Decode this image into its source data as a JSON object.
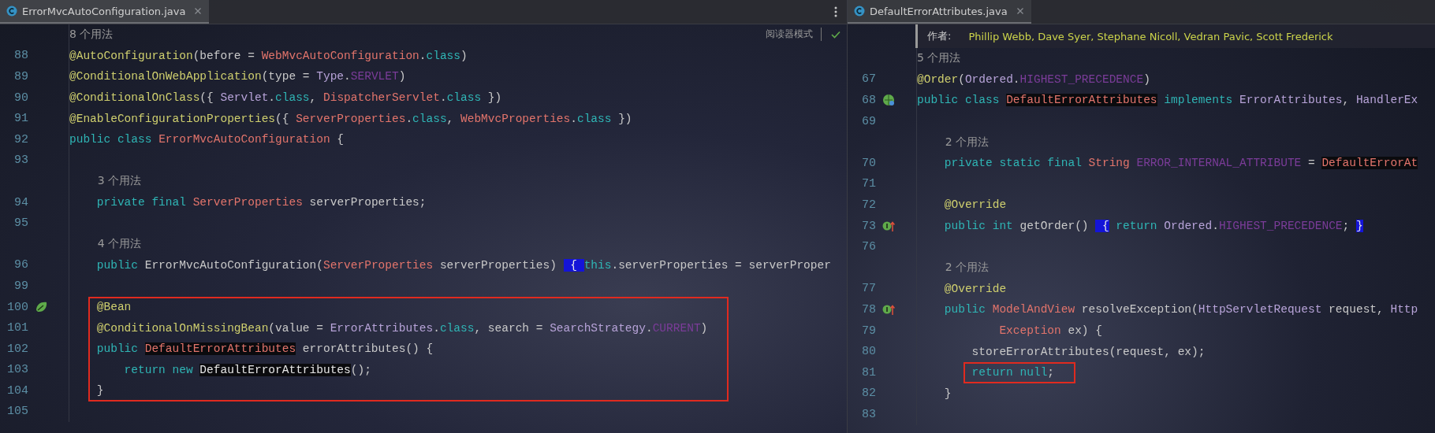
{
  "panes": [
    {
      "tab": {
        "title": "ErrorMvcAutoConfiguration.java"
      },
      "reader_mode": "阅读器模式",
      "lines": [
        {
          "kind": "usage",
          "text": "8 个用法",
          "indented": false
        },
        {
          "kind": "code",
          "number": "88",
          "boxed": false,
          "tokens": [
            {
              "t": "@AutoConfiguration",
              "kind": "an"
            },
            {
              "t": "(before = ",
              "kind": "p"
            },
            {
              "t": "WebMvcAutoConfiguration",
              "kind": "cls"
            },
            {
              "t": ".",
              "kind": "p"
            },
            {
              "t": "class",
              "kind": "kw"
            },
            {
              "t": ")",
              "kind": "p"
            }
          ]
        },
        {
          "kind": "code",
          "number": "89",
          "boxed": false,
          "tokens": [
            {
              "t": "@ConditionalOnWebApplication",
              "kind": "an"
            },
            {
              "t": "(type = ",
              "kind": "p"
            },
            {
              "t": "Type",
              "kind": "typ"
            },
            {
              "t": ".",
              "kind": "p"
            },
            {
              "t": "SERVLET",
              "kind": "cst"
            },
            {
              "t": ")",
              "kind": "p"
            }
          ]
        },
        {
          "kind": "code",
          "number": "90",
          "boxed": false,
          "tokens": [
            {
              "t": "@ConditionalOnClass",
              "kind": "an"
            },
            {
              "t": "({ ",
              "kind": "p"
            },
            {
              "t": "Servlet",
              "kind": "typ"
            },
            {
              "t": ".",
              "kind": "p"
            },
            {
              "t": "class",
              "kind": "kw"
            },
            {
              "t": ", ",
              "kind": "p"
            },
            {
              "t": "DispatcherServlet",
              "kind": "cls"
            },
            {
              "t": ".",
              "kind": "p"
            },
            {
              "t": "class",
              "kind": "kw"
            },
            {
              "t": " })",
              "kind": "p"
            }
          ]
        },
        {
          "kind": "code",
          "number": "91",
          "boxed": false,
          "tokens": [
            {
              "t": "@EnableConfigurationProperties",
              "kind": "an"
            },
            {
              "t": "({ ",
              "kind": "p"
            },
            {
              "t": "ServerProperties",
              "kind": "cls"
            },
            {
              "t": ".",
              "kind": "p"
            },
            {
              "t": "class",
              "kind": "kw"
            },
            {
              "t": ", ",
              "kind": "p"
            },
            {
              "t": "WebMvcProperties",
              "kind": "cls"
            },
            {
              "t": ".",
              "kind": "p"
            },
            {
              "t": "class",
              "kind": "kw"
            },
            {
              "t": " })",
              "kind": "p"
            }
          ]
        },
        {
          "kind": "code",
          "number": "92",
          "boxed": false,
          "tokens": [
            {
              "t": "public class ",
              "kind": "kw"
            },
            {
              "t": "ErrorMvcAutoConfiguration",
              "kind": "cls"
            },
            {
              "t": " {",
              "kind": "p"
            }
          ]
        },
        {
          "kind": "code",
          "number": "93",
          "boxed": false
        },
        {
          "kind": "usage",
          "text": "3 个用法",
          "indented": true
        },
        {
          "kind": "code",
          "number": "94",
          "boxed": false,
          "tokens": [
            {
              "t": "    private final ",
              "kind": "kw"
            },
            {
              "t": "ServerProperties",
              "kind": "cls"
            },
            {
              "t": " serverProperties;",
              "kind": "p"
            }
          ]
        },
        {
          "kind": "code",
          "number": "95",
          "boxed": false
        },
        {
          "kind": "usage",
          "text": "4 个用法",
          "indented": true
        },
        {
          "kind": "code",
          "number": "96",
          "boxed": false,
          "tokens": [
            {
              "t": "    public ",
              "kind": "kw"
            },
            {
              "t": "ErrorMvcAutoConfiguration(",
              "kind": "p"
            },
            {
              "t": "ServerProperties",
              "kind": "cls"
            },
            {
              "t": " serverProperties) ",
              "kind": "p"
            },
            {
              "t": " { ",
              "kind": "br"
            },
            {
              "t": "this",
              "kind": "kw"
            },
            {
              "t": ".serverProperties = serverProper",
              "kind": "p"
            }
          ]
        },
        {
          "kind": "code",
          "number": "99",
          "boxed": false
        },
        {
          "kind": "code",
          "number": "100",
          "gutter": {
            "kind": "bean"
          },
          "boxed": true,
          "tokens": [
            {
              "t": "    @Bean",
              "kind": "an"
            }
          ]
        },
        {
          "kind": "code",
          "number": "101",
          "boxed": true,
          "tokens": [
            {
              "t": "    @ConditionalOnMissingBean",
              "kind": "an"
            },
            {
              "t": "(value = ",
              "kind": "p"
            },
            {
              "t": "ErrorAttributes",
              "kind": "typ"
            },
            {
              "t": ".",
              "kind": "p"
            },
            {
              "t": "class",
              "kind": "kw"
            },
            {
              "t": ", search = ",
              "kind": "p"
            },
            {
              "t": "SearchStrategy",
              "kind": "typ"
            },
            {
              "t": ".",
              "kind": "p"
            },
            {
              "t": "CURRENT",
              "kind": "cst"
            },
            {
              "t": ")",
              "kind": "p"
            }
          ]
        },
        {
          "kind": "code",
          "number": "102",
          "boxed": true,
          "tokens": [
            {
              "t": "    public ",
              "kind": "kw"
            },
            {
              "t": "DefaultErrorAttributes",
              "kind": "clshl"
            },
            {
              "t": " errorAttributes() {",
              "kind": "p"
            }
          ]
        },
        {
          "kind": "code",
          "number": "103",
          "boxed": true,
          "tokens": [
            {
              "t": "        return new ",
              "kind": "kw"
            },
            {
              "t": "DefaultErrorAttributes",
              "kind": "plhl"
            },
            {
              "t": "();",
              "kind": "p"
            }
          ]
        },
        {
          "kind": "code",
          "number": "104",
          "boxed": true,
          "tokens": [
            {
              "t": "    }",
              "kind": "p"
            }
          ]
        },
        {
          "kind": "code",
          "number": "105",
          "boxed": false
        }
      ]
    },
    {
      "tab": {
        "title": "DefaultErrorAttributes.java"
      },
      "lines": [
        {
          "kind": "doc",
          "label": "作者:",
          "text": "Phillip Webb, Dave Syer, Stephane Nicoll, Vedran Pavic, Scott Frederick"
        },
        {
          "kind": "usage",
          "text": "5 个用法",
          "indented": false
        },
        {
          "kind": "code",
          "number": "67",
          "boxed": false,
          "tokens": [
            {
              "t": "@Order",
              "kind": "an"
            },
            {
              "t": "(",
              "kind": "p"
            },
            {
              "t": "Ordered",
              "kind": "typ"
            },
            {
              "t": ".",
              "kind": "p"
            },
            {
              "t": "HIGHEST_PRECEDENCE",
              "kind": "cst"
            },
            {
              "t": ")",
              "kind": "p"
            }
          ]
        },
        {
          "kind": "code",
          "number": "68",
          "gutter": {
            "kind": "class"
          },
          "boxed": false,
          "tokens": [
            {
              "t": "public class ",
              "kind": "kw"
            },
            {
              "t": "DefaultErrorAttributes",
              "kind": "clshl"
            },
            {
              "t": " implements ",
              "kind": "kw"
            },
            {
              "t": "ErrorAttributes",
              "kind": "typ"
            },
            {
              "t": ", ",
              "kind": "p"
            },
            {
              "t": "HandlerEx",
              "kind": "typ"
            }
          ]
        },
        {
          "kind": "code",
          "number": "69",
          "boxed": false
        },
        {
          "kind": "usage",
          "text": "2 个用法",
          "indented": true
        },
        {
          "kind": "code",
          "number": "70",
          "boxed": false,
          "tokens": [
            {
              "t": "    private static final ",
              "kind": "kw"
            },
            {
              "t": "String",
              "kind": "cls"
            },
            {
              "t": " ERROR_INTERNAL_ATTRIBUTE",
              "kind": "cst"
            },
            {
              "t": " = ",
              "kind": "p"
            },
            {
              "t": "DefaultErrorAt",
              "kind": "clshl"
            }
          ]
        },
        {
          "kind": "code",
          "number": "71",
          "boxed": false
        },
        {
          "kind": "code",
          "number": "72",
          "boxed": false,
          "tokens": [
            {
              "t": "    @Override",
              "kind": "an"
            }
          ]
        },
        {
          "kind": "code",
          "number": "73",
          "gutter": {
            "kind": "override"
          },
          "boxed": false,
          "tokens": [
            {
              "t": "    public int ",
              "kind": "kw"
            },
            {
              "t": "getOrder() ",
              "kind": "p"
            },
            {
              "t": " {",
              "kind": "br"
            },
            {
              "t": " return ",
              "kind": "kw"
            },
            {
              "t": "Ordered",
              "kind": "typ"
            },
            {
              "t": ".",
              "kind": "p"
            },
            {
              "t": "HIGHEST_PRECEDENCE",
              "kind": "cst"
            },
            {
              "t": "; ",
              "kind": "p"
            },
            {
              "t": "}",
              "kind": "br"
            }
          ]
        },
        {
          "kind": "code",
          "number": "76",
          "boxed": false
        },
        {
          "kind": "usage",
          "text": "2 个用法",
          "indented": true
        },
        {
          "kind": "code",
          "number": "77",
          "boxed": false,
          "tokens": [
            {
              "t": "    @Override",
              "kind": "an"
            }
          ]
        },
        {
          "kind": "code",
          "number": "78",
          "gutter": {
            "kind": "override"
          },
          "boxed": false,
          "tokens": [
            {
              "t": "    public ",
              "kind": "kw"
            },
            {
              "t": "ModelAndView",
              "kind": "cls"
            },
            {
              "t": " resolveException(",
              "kind": "p"
            },
            {
              "t": "HttpServletRequest",
              "kind": "typ"
            },
            {
              "t": " request, ",
              "kind": "p"
            },
            {
              "t": "Http",
              "kind": "typ"
            }
          ]
        },
        {
          "kind": "code",
          "number": "79",
          "boxed": false,
          "tokens": [
            {
              "t": "            Exception",
              "kind": "cls"
            },
            {
              "t": " ex) {",
              "kind": "p"
            }
          ]
        },
        {
          "kind": "code",
          "number": "80",
          "boxed": false,
          "tokens": [
            {
              "t": "        storeErrorAttributes(request, ex);",
              "kind": "p"
            }
          ]
        },
        {
          "kind": "code",
          "number": "81",
          "boxed": true,
          "tokens": [
            {
              "t": "        return null",
              "kind": "kw"
            },
            {
              "t": ";",
              "kind": "p"
            }
          ]
        },
        {
          "kind": "code",
          "number": "82",
          "boxed": false,
          "tokens": [
            {
              "t": "    }",
              "kind": "p"
            }
          ]
        },
        {
          "kind": "code",
          "number": "83",
          "boxed": false
        }
      ]
    }
  ]
}
